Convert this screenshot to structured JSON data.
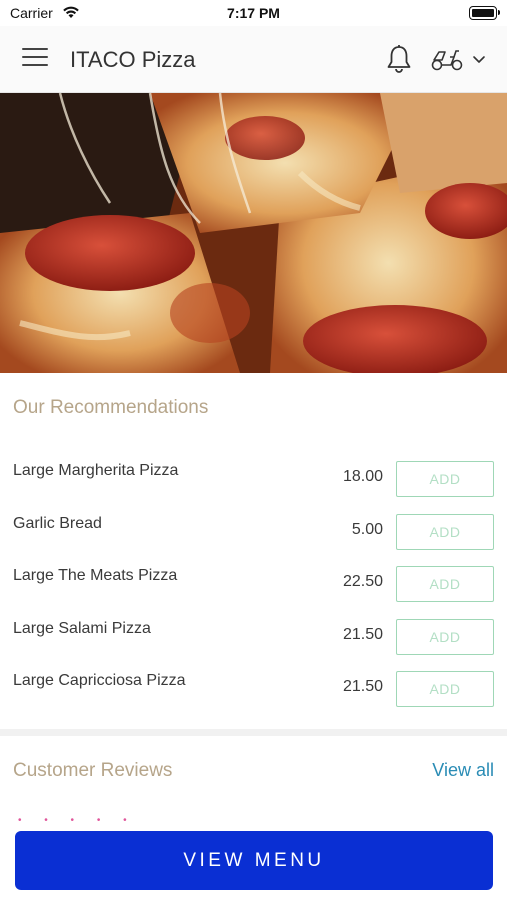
{
  "status": {
    "carrier": "Carrier",
    "time": "7:17 PM"
  },
  "header": {
    "title": "ITACO Pizza"
  },
  "recommendations": {
    "title": "Our Recommendations",
    "add_label": "ADD",
    "items": [
      {
        "name": "Large Margherita Pizza",
        "price": "18.00"
      },
      {
        "name": "Garlic Bread",
        "price": "5.00"
      },
      {
        "name": "Large The Meats Pizza",
        "price": "22.50"
      },
      {
        "name": "Large Salami Pizza",
        "price": "21.50"
      },
      {
        "name": "Large Capricciosa Pizza",
        "price": "21.50"
      }
    ]
  },
  "reviews": {
    "title": "Customer Reviews",
    "view_all": "View all",
    "stars": "• • • • •"
  },
  "cta": {
    "label": "VIEW MENU"
  },
  "colors": {
    "accent_gold": "#b6a58a",
    "cta_blue": "#0a2fd3",
    "add_green": "#9fd7b6",
    "link_blue": "#2a8cb5",
    "star_pink": "#e0569b"
  },
  "icons": [
    "wifi-icon",
    "battery-icon",
    "hamburger-menu-icon",
    "bell-icon",
    "delivery-scooter-icon",
    "chevron-down-icon"
  ]
}
